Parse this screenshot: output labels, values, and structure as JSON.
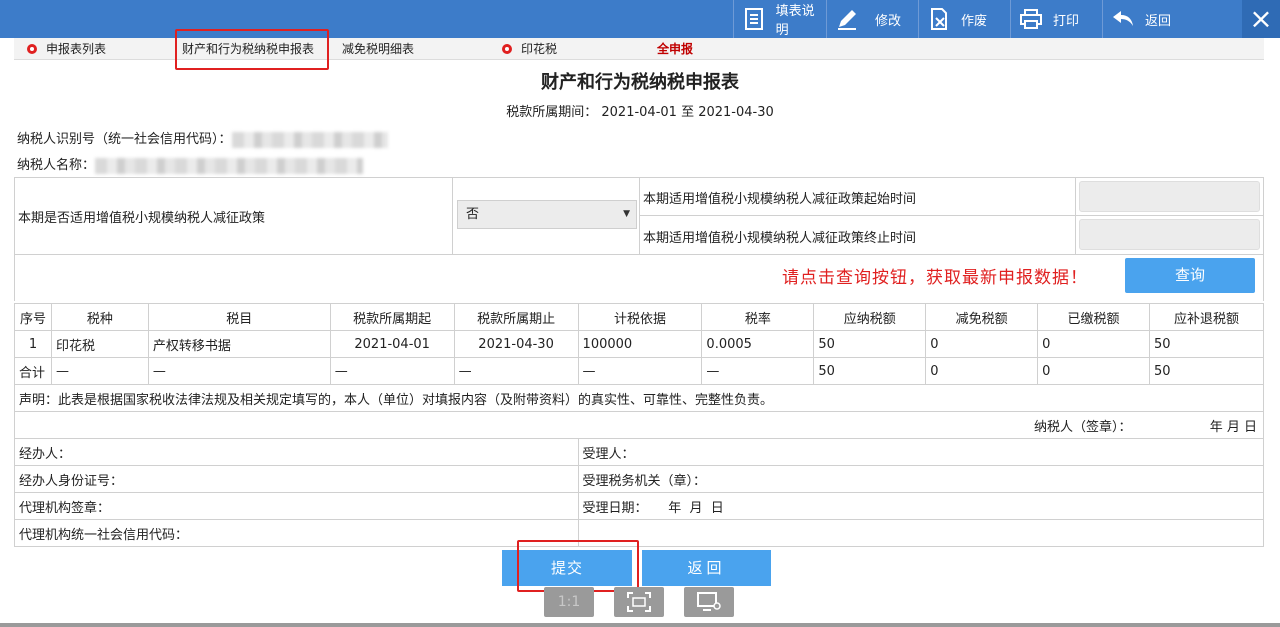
{
  "toolbar": {
    "guide": "填表说明",
    "edit": "修改",
    "void": "作废",
    "print": "打印",
    "back": "返回",
    "close": "×"
  },
  "tabs": {
    "list": "申报表列表",
    "property": "财产和行为税纳税申报表",
    "relief": "减免税明细表",
    "stamp": "印花税",
    "all": "全申报"
  },
  "form": {
    "title": "财产和行为税纳税申报表",
    "period": "税款所属期间： 2021-04-01 至 2021-04-30",
    "taxpayer_id_label": "纳税人识别号（统一社会信用代码）：",
    "taxpayer_name_label": "纳税人名称："
  },
  "policy": {
    "question": "本期是否适用增值税小规模纳税人减征政策",
    "selected": "否",
    "start_label": "本期适用增值税小规模纳税人减征政策起始时间",
    "end_label": "本期适用增值税小规模纳税人减征政策终止时间",
    "notice": "请点击查询按钮，获取最新申报数据！",
    "query_button": "查询"
  },
  "table": {
    "headers": [
      "序号",
      "税种",
      "税目",
      "税款所属期起",
      "税款所属期止",
      "计税依据",
      "税率",
      "应纳税额",
      "减免税额",
      "已缴税额",
      "应补退税额"
    ],
    "rows": [
      [
        "1",
        "印花税",
        "产权转移书据",
        "2021-04-01",
        "2021-04-30",
        "100000",
        "0.0005",
        "50",
        "0",
        "0",
        "50"
      ],
      [
        "合计",
        "—",
        "—",
        "—",
        "—",
        "—",
        "—",
        "50",
        "0",
        "0",
        "50"
      ]
    ],
    "declaration": "声明：此表是根据国家税收法律法规及相关规定填写的，本人（单位）对填报内容（及附带资料）的真实性、可靠性、完整性负责。",
    "taxpayer_sign": "纳税人（签章）：",
    "sign_date": "年  月  日",
    "handler": "经办人：",
    "receiver": "受理人：",
    "handler_id": "经办人身份证号：",
    "tax_office": "受理税务机关（章）：",
    "agency_sign": "代理机构签章：",
    "accept_date": "受理日期：     年  月  日",
    "agency_code": "代理机构统一社会信用代码："
  },
  "actions": {
    "submit": "提交",
    "back": "返回"
  },
  "viewer": {
    "actual_size": "1:1"
  },
  "colors": {
    "toolbar": "#3d7cc9",
    "button": "#4aa3ee",
    "notice": "#e02020",
    "highlight_box": "#e02020"
  }
}
